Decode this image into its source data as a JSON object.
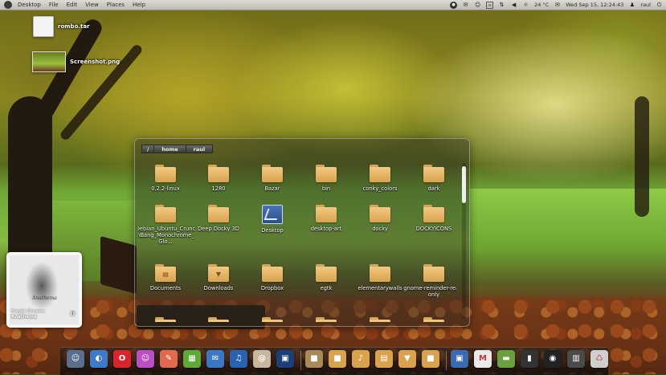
{
  "top_panel": {
    "menus": [
      "Desktop",
      "File",
      "Edit",
      "View",
      "Places",
      "Help"
    ],
    "weather": "24 °C",
    "datetime": "Wed Sep 15, 12:24:43",
    "user": "raul"
  },
  "desktop_icons": [
    {
      "label": "rombo.tar",
      "kind": "file"
    },
    {
      "label": "Screenshot.png",
      "kind": "image"
    }
  ],
  "stack": {
    "breadcrumb": [
      "/",
      "home",
      "raul"
    ],
    "items": [
      {
        "label": "0.2.2-linux",
        "icon": "folder-icon"
      },
      {
        "label": "1280",
        "icon": "folder-icon"
      },
      {
        "label": "Bazar",
        "icon": "folder-icon"
      },
      {
        "label": "bin",
        "icon": "folder-icon"
      },
      {
        "label": "conky_colors",
        "icon": "folder-icon"
      },
      {
        "label": "dark",
        "icon": "folder-icon"
      },
      {
        "label": "Debian_Ubuntu_CrunchBang_Monochrome_Glo...",
        "icon": "folder-icon"
      },
      {
        "label": "Deep Docky 3D",
        "icon": "folder-icon"
      },
      {
        "label": "Desktop",
        "icon": "desktop-folder-icon"
      },
      {
        "label": "desktop-art",
        "icon": "folder-icon"
      },
      {
        "label": "docky",
        "icon": "folder-icon"
      },
      {
        "label": "DOCKYICONS",
        "icon": "folder-icon"
      },
      {
        "label": "Documents",
        "icon": "documents-folder-icon"
      },
      {
        "label": "Downloads",
        "icon": "downloads-folder-icon"
      },
      {
        "label": "Dropbox",
        "icon": "folder-icon"
      },
      {
        "label": "egtk",
        "icon": "folder-icon"
      },
      {
        "label": "elementarywalls",
        "icon": "folder-icon"
      },
      {
        "label": "gnome-reminder-read-only",
        "icon": "folder-icon"
      }
    ]
  },
  "music_widget": {
    "album_caption": "Anathema",
    "track_title": "Fragile Dreams",
    "artist": "Anathema"
  },
  "dock": {
    "icons": [
      {
        "name": "trash-dock-icon",
        "color": "#5b6f8c",
        "glyph": "☺"
      },
      {
        "name": "chrome-dock-icon",
        "color": "#3f79c8",
        "glyph": "◐"
      },
      {
        "name": "opera-dock-icon",
        "color": "#d9242b",
        "glyph": "O"
      },
      {
        "name": "empathy-dock-icon",
        "color": "#b94fc2",
        "glyph": "☺"
      },
      {
        "name": "gimp-dock-icon",
        "color": "#e26a4c",
        "glyph": "✎"
      },
      {
        "name": "spreadsheet-dock-icon",
        "color": "#5fa83a",
        "glyph": "▦"
      },
      {
        "name": "thunderbird-dock-icon",
        "color": "#3b77c2",
        "glyph": "✉"
      },
      {
        "name": "music-player-dock-icon",
        "color": "#2a62b0",
        "glyph": "♫"
      },
      {
        "name": "mail-dock-icon",
        "color": "#c9b8a0",
        "glyph": "@"
      },
      {
        "name": "monitor-dock-icon",
        "color": "#1c3f78",
        "glyph": "▣"
      },
      {
        "name": "folder-dock-icon-1",
        "color": "#a88a5a",
        "glyph": "■"
      },
      {
        "name": "folder-dock-icon-2",
        "color": "#d9a24e",
        "glyph": "■"
      },
      {
        "name": "folder-dock-icon-3",
        "color": "#d9a24e",
        "glyph": "♪"
      },
      {
        "name": "folder-dock-icon-4",
        "color": "#d9a24e",
        "glyph": "▤"
      },
      {
        "name": "folder-dock-icon-5",
        "color": "#d9a24e",
        "glyph": "▼"
      },
      {
        "name": "folder-dock-icon-6",
        "color": "#d9a24e",
        "glyph": "■"
      },
      {
        "name": "desktop-dock-icon",
        "color": "#3b6ab0",
        "glyph": "▣"
      },
      {
        "name": "gmail-dock-icon",
        "color": "#e9e9e9",
        "glyph": "M"
      },
      {
        "name": "photo-dock-icon",
        "color": "#6aa040",
        "glyph": "▬"
      },
      {
        "name": "system-monitor-dock-icon",
        "color": "#333333",
        "glyph": "▮"
      },
      {
        "name": "clock-dock-icon",
        "color": "#222222",
        "glyph": "◉"
      },
      {
        "name": "workspace-dock-icon",
        "color": "#4a4a4a",
        "glyph": "▥"
      },
      {
        "name": "trash-can-dock-icon",
        "color": "#cfcfcf",
        "glyph": "♺"
      }
    ]
  }
}
